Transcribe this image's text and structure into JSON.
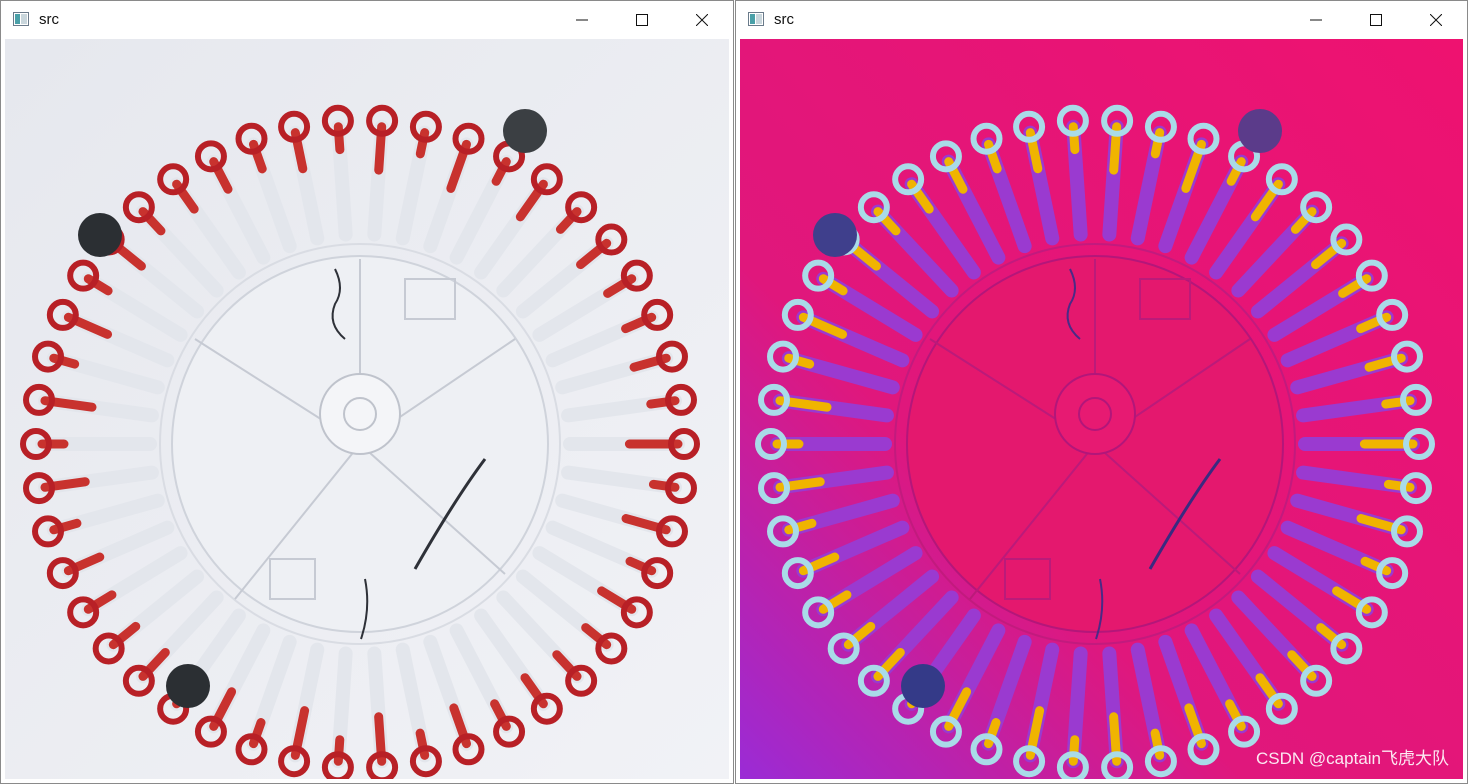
{
  "windows": [
    {
      "title": "src",
      "controls": {
        "minimize": "minimize-icon",
        "maximize": "maximize-icon",
        "close": "close-icon"
      },
      "image": {
        "type": "photo",
        "description_colors": {
          "background": "#e9ebf1",
          "fluid": "#c0272d",
          "markers": "#2b2f33"
        }
      }
    },
    {
      "title": "src",
      "controls": {
        "minimize": "minimize-icon",
        "maximize": "maximize-icon",
        "close": "close-icon"
      },
      "image": {
        "type": "false-color",
        "description_colors": {
          "background": "#ea1670",
          "fluid": "#f2c200",
          "loops": "#a9dbe8",
          "markers": "#3a3a8a"
        }
      },
      "watermark": "CSDN @captain飞虎大队"
    }
  ]
}
